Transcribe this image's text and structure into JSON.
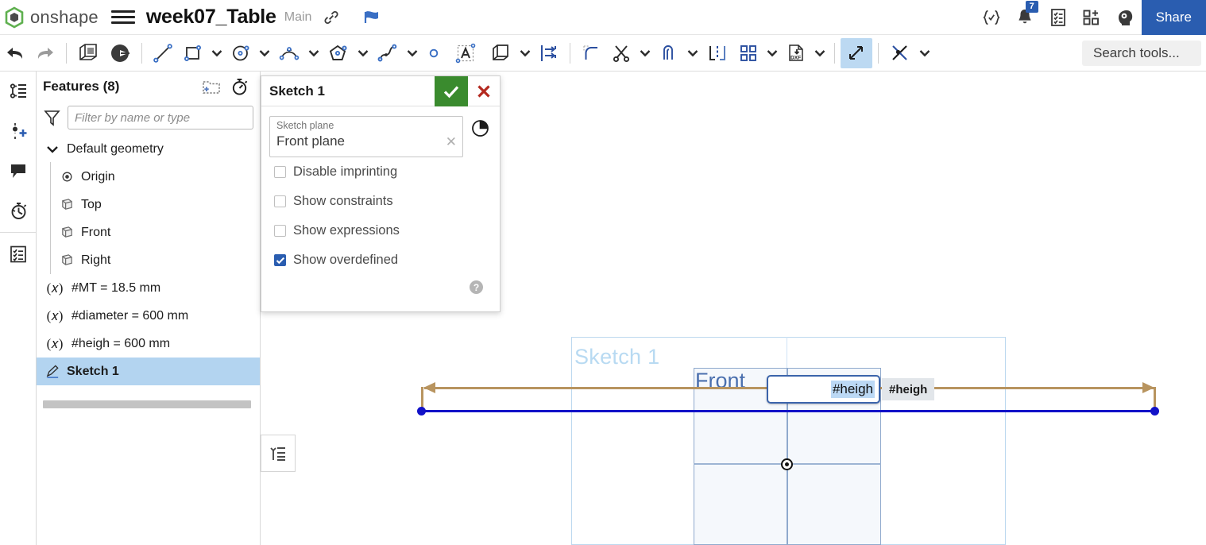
{
  "header": {
    "brand": "onshape",
    "menu_icon": "hamburger-icon",
    "document_title": "week07_Table",
    "branch": "Main",
    "link_icon": "link-icon",
    "flag_icon": "flag-icon",
    "right_icons": [
      {
        "name": "featurescript-icon",
        "glyph": "{✓}"
      },
      {
        "name": "notifications-bell-icon",
        "badge": "7"
      },
      {
        "name": "tasks-list-icon",
        "glyph": ""
      },
      {
        "name": "app-store-icon",
        "glyph": ""
      },
      {
        "name": "learning-center-icon",
        "glyph": ""
      }
    ],
    "share_label": "Share"
  },
  "toolbar": {
    "items": [
      {
        "name": "undo-button",
        "caret": false
      },
      {
        "name": "redo-button",
        "caret": false
      },
      {
        "name": "sketch-insert-button",
        "caret": false
      },
      {
        "name": "sketch-fill-button",
        "caret": false
      },
      {
        "name": "line-tool",
        "caret": false
      },
      {
        "name": "rectangle-tool",
        "caret": true
      },
      {
        "name": "circle-tool",
        "caret": true
      },
      {
        "name": "arc-tool",
        "caret": true
      },
      {
        "name": "polygon-tool",
        "caret": true
      },
      {
        "name": "spline-tool",
        "caret": true
      },
      {
        "name": "point-tool",
        "caret": false
      },
      {
        "name": "text-tool",
        "caret": false
      },
      {
        "name": "offset-tool",
        "caret": true
      },
      {
        "name": "mirror-tool",
        "caret": false
      },
      {
        "name": "fillet-tool",
        "caret": false
      },
      {
        "name": "trim-tool",
        "caret": true
      },
      {
        "name": "extend-tool",
        "caret": true
      },
      {
        "name": "use-projection-tool",
        "caret": false
      },
      {
        "name": "linear-pattern-tool",
        "caret": true
      },
      {
        "name": "import-dxf-tool",
        "caret": true
      },
      {
        "name": "dimension-tool",
        "caret": false,
        "active": true
      },
      {
        "name": "constraint-tool",
        "caret": true
      }
    ],
    "search_placeholder": "Search tools..."
  },
  "rail": {
    "items": [
      {
        "name": "rail-feature-list-icon"
      },
      {
        "name": "rail-add-variable-icon"
      },
      {
        "name": "rail-comments-icon"
      },
      {
        "name": "rail-history-icon"
      },
      {
        "name": "rail-tasks-icon"
      }
    ]
  },
  "features": {
    "title": "Features (8)",
    "add_folder_icon": "add-folder-icon",
    "rollback_icon": "rollback-timer-icon",
    "filter_icon": "filter-funnel-icon",
    "filter_placeholder": "Filter by name or type",
    "tree": [
      {
        "name": "default-geometry",
        "label": "Default geometry",
        "icon": "chevron-down-icon",
        "kind": "group",
        "child": false,
        "selected": false
      },
      {
        "name": "origin",
        "label": "Origin",
        "icon": "origin-icon",
        "kind": "item",
        "child": true,
        "selected": false
      },
      {
        "name": "plane-top",
        "label": "Top",
        "icon": "plane-icon",
        "kind": "item",
        "child": true,
        "selected": false
      },
      {
        "name": "plane-front",
        "label": "Front",
        "icon": "plane-icon",
        "kind": "item",
        "child": true,
        "selected": false
      },
      {
        "name": "plane-right",
        "label": "Right",
        "icon": "plane-icon",
        "kind": "item",
        "child": true,
        "selected": false
      },
      {
        "name": "variable-mt",
        "label": "#MT = 18.5 mm",
        "icon": "variable-icon",
        "kind": "variable",
        "child": false,
        "selected": false
      },
      {
        "name": "variable-diameter",
        "label": "#diameter = 600 mm",
        "icon": "variable-icon",
        "kind": "variable",
        "child": false,
        "selected": false
      },
      {
        "name": "variable-heigh",
        "label": "#heigh = 600 mm",
        "icon": "variable-icon",
        "kind": "variable",
        "child": false,
        "selected": false
      },
      {
        "name": "sketch-1",
        "label": "Sketch 1",
        "icon": "sketch-pencil-icon",
        "kind": "item",
        "child": false,
        "selected": true
      }
    ]
  },
  "sketch_dialog": {
    "title": "Sketch 1",
    "accept_icon": "checkmark-icon",
    "cancel_icon": "close-x-icon",
    "plane_field": {
      "label": "Sketch plane",
      "value": "Front plane",
      "clear_icon": "clear-x-icon"
    },
    "section_view_icon": "section-view-icon",
    "checkboxes": [
      {
        "name": "disable-imprinting",
        "label": "Disable imprinting",
        "checked": false
      },
      {
        "name": "show-constraints",
        "label": "Show constraints",
        "checked": false
      },
      {
        "name": "show-expressions",
        "label": "Show expressions",
        "checked": false
      },
      {
        "name": "show-overdefined",
        "label": "Show overdefined",
        "checked": true
      }
    ],
    "help_icon": "help-question-icon"
  },
  "canvas": {
    "sketch_label": "Sketch 1",
    "plane_label": "Front",
    "dimension_input_value": "#heigh",
    "dimension_tooltip": "#heigh",
    "sketch_panel_toggle_icon": "sketch-panel-list-icon",
    "origin_marker": "origin-point-marker"
  },
  "colors": {
    "brand_green": "#5fb04f",
    "accent_blue": "#2a5db0",
    "selection_blue": "#b3d4f0",
    "ok_green": "#3a8b2e",
    "cancel_red": "#c0392b",
    "dimension_tan": "#b8945f",
    "sketch_line_blue": "#1212c8",
    "plane_blue": "#8fa9cd",
    "sketch_label_blue": "#b8daf2"
  }
}
